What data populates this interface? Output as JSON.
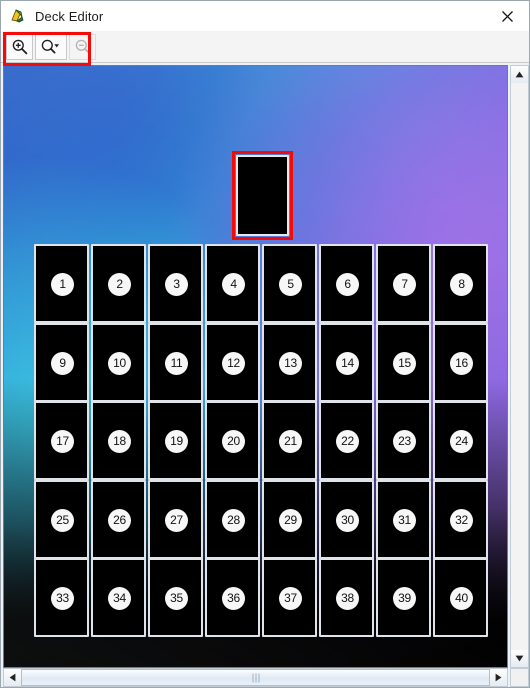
{
  "window": {
    "title": "Deck Editor",
    "app_icon": "deck-editor-app-icon",
    "close_label": "✕"
  },
  "toolbar": {
    "buttons": [
      {
        "name": "zoom-in-button",
        "icon": "magnifier-plus-icon",
        "label": "Zoom In",
        "enabled": true
      },
      {
        "name": "zoom-preset-button",
        "icon": "magnifier-dropdown-icon",
        "label": "Zoom Level",
        "enabled": true
      },
      {
        "name": "zoom-out-button",
        "icon": "magnifier-minus-icon",
        "label": "Zoom Out",
        "enabled": false
      }
    ],
    "highlight_color": "#f40a0a"
  },
  "board": {
    "background_colors": {
      "top_left": "#2a5fc4",
      "left_mid": "#35a6dd",
      "right": "#9a6ae0",
      "bottom": "#05050c"
    },
    "card_face_color": "#000000",
    "card_border_color": "#dfe4ea",
    "selected_card": {
      "name": "deck-top-card",
      "label": "",
      "highlighted": true
    },
    "grid": {
      "columns": 8,
      "rows": 5,
      "cards": [
        {
          "num": "1"
        },
        {
          "num": "2"
        },
        {
          "num": "3"
        },
        {
          "num": "4"
        },
        {
          "num": "5"
        },
        {
          "num": "6"
        },
        {
          "num": "7"
        },
        {
          "num": "8"
        },
        {
          "num": "9"
        },
        {
          "num": "10"
        },
        {
          "num": "11"
        },
        {
          "num": "12"
        },
        {
          "num": "13"
        },
        {
          "num": "14"
        },
        {
          "num": "15"
        },
        {
          "num": "16"
        },
        {
          "num": "17"
        },
        {
          "num": "18"
        },
        {
          "num": "19"
        },
        {
          "num": "20"
        },
        {
          "num": "21"
        },
        {
          "num": "22"
        },
        {
          "num": "23"
        },
        {
          "num": "24"
        },
        {
          "num": "25"
        },
        {
          "num": "26"
        },
        {
          "num": "27"
        },
        {
          "num": "28"
        },
        {
          "num": "29"
        },
        {
          "num": "30"
        },
        {
          "num": "31"
        },
        {
          "num": "32"
        },
        {
          "num": "33"
        },
        {
          "num": "34"
        },
        {
          "num": "35"
        },
        {
          "num": "36"
        },
        {
          "num": "37"
        },
        {
          "num": "38"
        },
        {
          "num": "39"
        },
        {
          "num": "40"
        }
      ]
    }
  },
  "scrollbars": {
    "vertical": {
      "up_arrow": "▲",
      "down_arrow": "▼"
    },
    "horizontal": {
      "left_arrow": "◀",
      "right_arrow": "▶"
    }
  }
}
